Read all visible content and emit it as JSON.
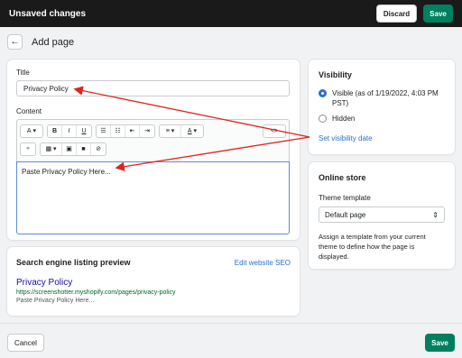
{
  "topbar": {
    "title": "Unsaved changes",
    "discard": "Discard",
    "save": "Save"
  },
  "header": {
    "title": "Add page"
  },
  "form": {
    "title_label": "Title",
    "title_value": "Privacy Policy",
    "content_label": "Content",
    "toolbar": {
      "font": "A",
      "bold": "B",
      "italic": "I",
      "underline": "U",
      "align": "≡",
      "color": "A",
      "code": "<>"
    },
    "content_value": "Paste Privacy Policy Here..."
  },
  "seo": {
    "heading": "Search engine listing preview",
    "edit_link": "Edit website SEO",
    "title": "Privacy Policy",
    "url": "https://screenshotter.myshopify.com/pages/privacy-policy",
    "description": "Paste Privacy Policy Here..."
  },
  "visibility": {
    "heading": "Visibility",
    "visible_label": "Visible (as of 1/19/2022, 4:03 PM PST)",
    "hidden_label": "Hidden",
    "set_date_link": "Set visibility date",
    "selected": "visible"
  },
  "online_store": {
    "heading": "Online store",
    "template_label": "Theme template",
    "template_value": "Default page",
    "help": "Assign a template from your current theme to define how the page is displayed."
  },
  "footer": {
    "cancel": "Cancel",
    "save": "Save"
  },
  "colors": {
    "primary": "#008060",
    "accent": "#2c6ecb",
    "annotation": "#e0241b"
  }
}
